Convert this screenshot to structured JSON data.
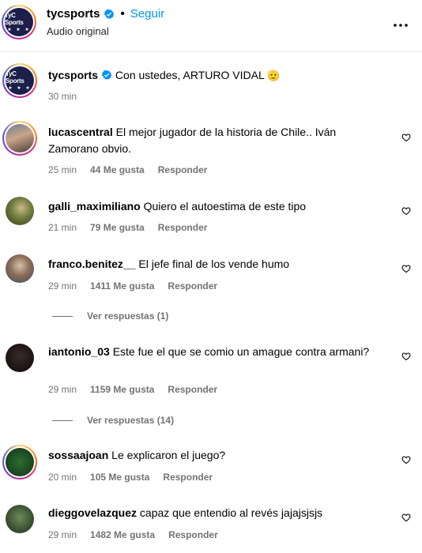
{
  "post": {
    "username": "tycsports",
    "follow_label": "Seguir",
    "audio_label": "Audio original",
    "separator": "•"
  },
  "caption": {
    "username": "tycsports",
    "text": "Con ustedes, ARTURO VIDAL",
    "emoji": "🫡",
    "time": "30 min"
  },
  "logo": {
    "text": "TyC Sports",
    "stars": "★ ★ ★"
  },
  "comments": [
    {
      "username": "lucascentral",
      "text": "El mejor jugador de la historia de Chile.. Iván Zamorano obvio.",
      "time": "25 min",
      "likes": "44 Me gusta",
      "reply": "Responder"
    },
    {
      "username": "galli_maximiliano",
      "text": "Quiero el autoestima de este tipo",
      "time": "21 min",
      "likes": "79 Me gusta",
      "reply": "Responder"
    },
    {
      "username": "franco.benitez__",
      "text": "El jefe final de los vende humo",
      "time": "29 min",
      "likes": "1411 Me gusta",
      "reply": "Responder",
      "view_replies": "Ver respuestas (1)"
    },
    {
      "username": "iantonio_03",
      "text": "Este fue el que se comio un amague contra armani?",
      "time": "29 min",
      "likes": "1159 Me gusta",
      "reply": "Responder",
      "view_replies": "Ver respuestas (14)"
    },
    {
      "username": "sossaajoan",
      "text": "Le explicaron el juego?",
      "time": "20 min",
      "likes": "105 Me gusta",
      "reply": "Responder"
    },
    {
      "username": "dieggovelazquez",
      "text": "capaz que entendio al revés jajajsjsjs",
      "time": "29 min",
      "likes": "1482 Me gusta",
      "reply": "Responder"
    }
  ],
  "colors": {
    "link_blue": "#0095f6",
    "verified_blue": "#0095f6",
    "meta_gray": "#737373",
    "logo_navy": "#1c1f4a"
  },
  "icons": {
    "verified": "verified-badge-icon",
    "heart": "heart-outline-icon",
    "more": "more-options-icon"
  }
}
